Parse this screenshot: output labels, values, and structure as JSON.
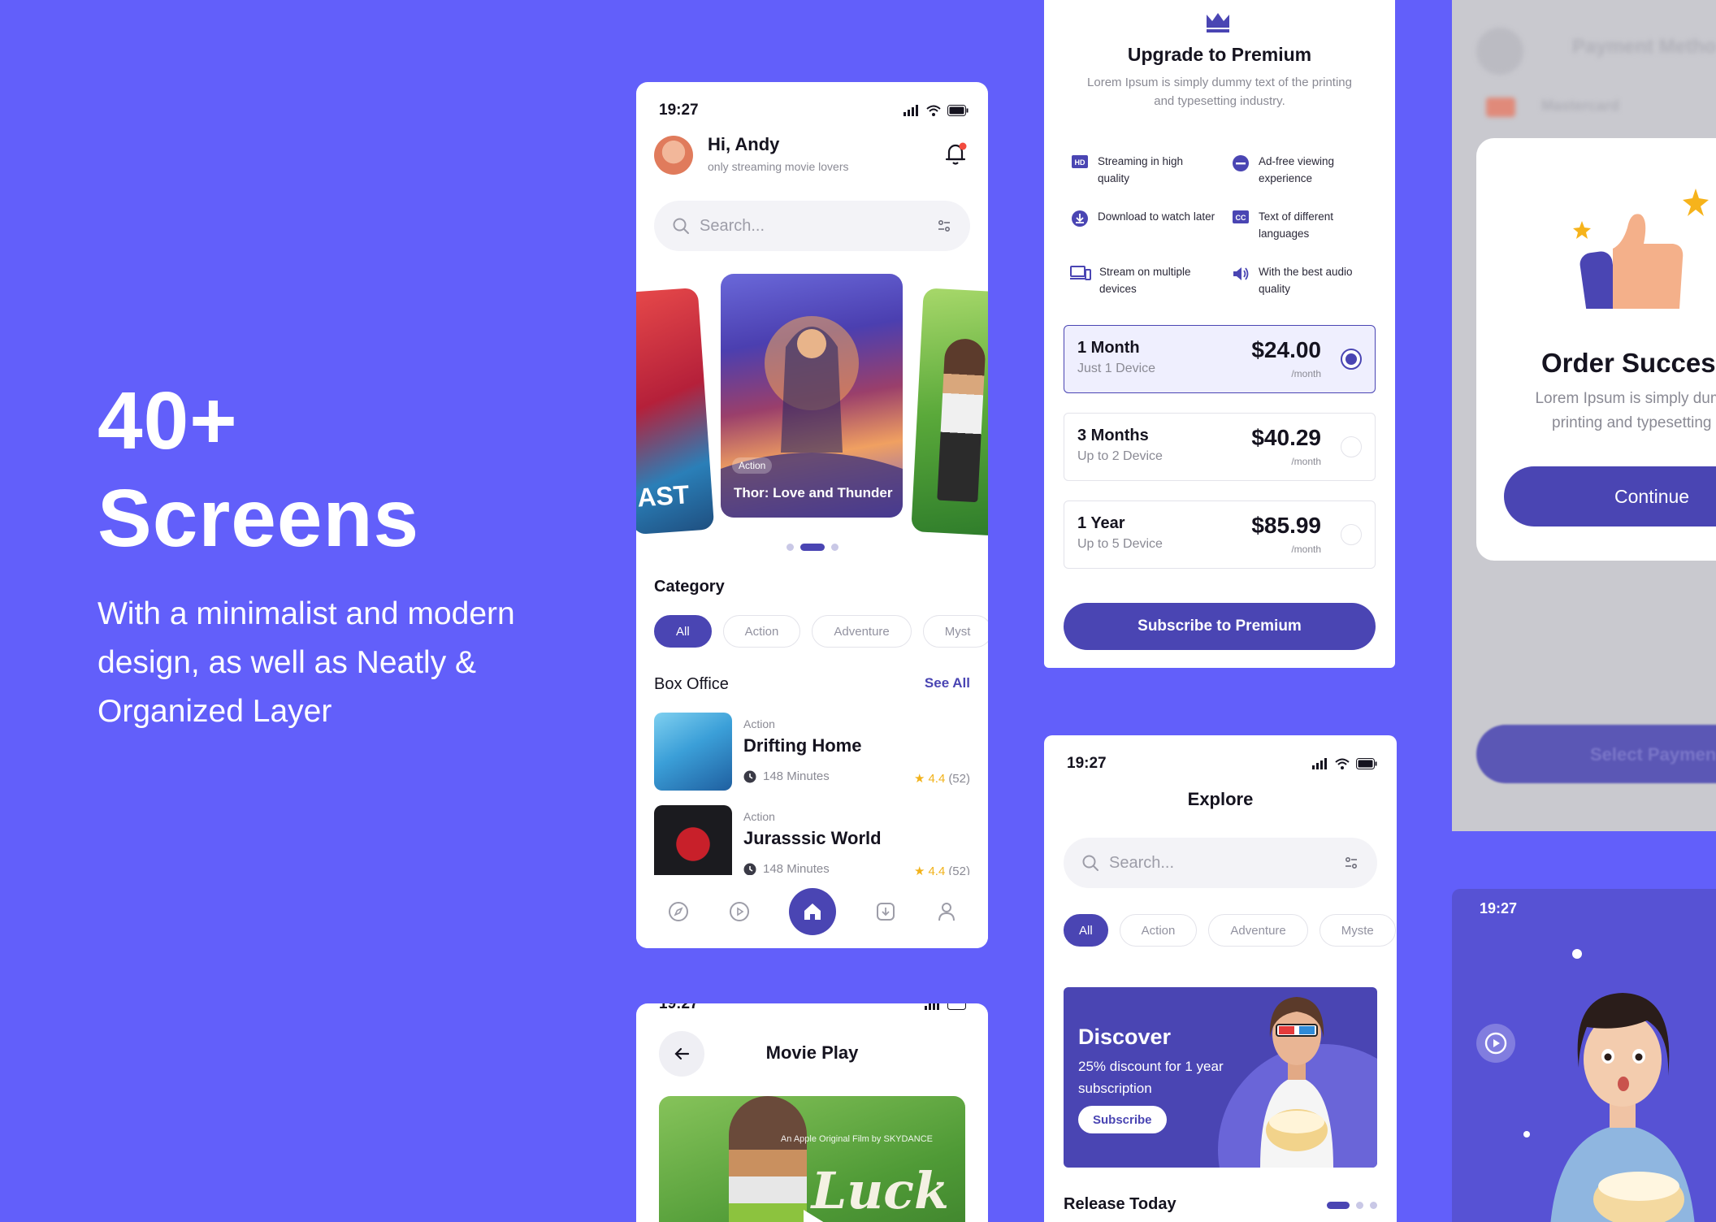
{
  "hero": {
    "title_line1": "40+",
    "title_line2": "Screens",
    "subtitle": "With a minimalist and modern design, as well as Neatly & Organized Layer"
  },
  "home": {
    "time": "19:27",
    "greeting": "Hi, Andy",
    "greeting_sub": "only streaming movie lovers",
    "search_placeholder": "Search...",
    "featured": {
      "genre": "Action",
      "title": "Thor: Love and Thunder"
    },
    "left_poster_text": "AST",
    "category_title": "Category",
    "categories": [
      "All",
      "Action",
      "Adventure",
      "Myst"
    ],
    "box_office_title": "Box Office",
    "see_all": "See All",
    "movies": [
      {
        "genre": "Action",
        "title": "Drifting Home",
        "duration": "148 Minutes",
        "rating": "4.4",
        "count": "(52)"
      },
      {
        "genre": "Action",
        "title": "Jurasssic World",
        "duration": "148 Minutes",
        "rating": "4.4",
        "count": "(52)"
      }
    ]
  },
  "play": {
    "time": "19:27",
    "title": "Movie Play",
    "credit": "An Apple Original Film by SKYDANCE",
    "logo": "Luck"
  },
  "premium": {
    "title": "Upgrade to Premium",
    "description": "Lorem Ipsum is simply dummy text of the printing and typesetting industry.",
    "features": [
      "Streaming in high quality",
      "Ad-free viewing experience",
      "Download to watch later",
      "Text of different languages",
      "Stream on multiple devices",
      "With the best audio quality"
    ],
    "plans": [
      {
        "name": "1 Month",
        "sub": "Just 1 Device",
        "price": "$24.00",
        "per": "/month",
        "selected": true
      },
      {
        "name": "3 Months",
        "sub": "Up to 2 Device",
        "price": "$40.29",
        "per": "/month",
        "selected": false
      },
      {
        "name": "1 Year",
        "sub": "Up to 5 Device",
        "price": "$85.99",
        "per": "/month",
        "selected": false
      }
    ],
    "subscribe_label": "Subscribe to Premium"
  },
  "explore": {
    "time": "19:27",
    "title": "Explore",
    "search_placeholder": "Search...",
    "categories": [
      "All",
      "Action",
      "Adventure",
      "Myste"
    ],
    "discover_title": "Discover",
    "discover_text": "25% discount for 1 year subscription",
    "discover_button": "Subscribe",
    "release_title": "Release Today"
  },
  "order": {
    "bg_title": "Payment Metho",
    "bg_item": "Mastercard",
    "title": "Order Succes",
    "description_line1": "Lorem Ipsum is simply dumm",
    "description_line2": "printing and typesetting i",
    "continue_label": "Continue",
    "bg_button": "Select Paymen"
  },
  "splash": {
    "time": "19:27"
  },
  "colors": {
    "background": "#625FFA",
    "accent": "#4A45B3",
    "star": "#F2B21A"
  }
}
